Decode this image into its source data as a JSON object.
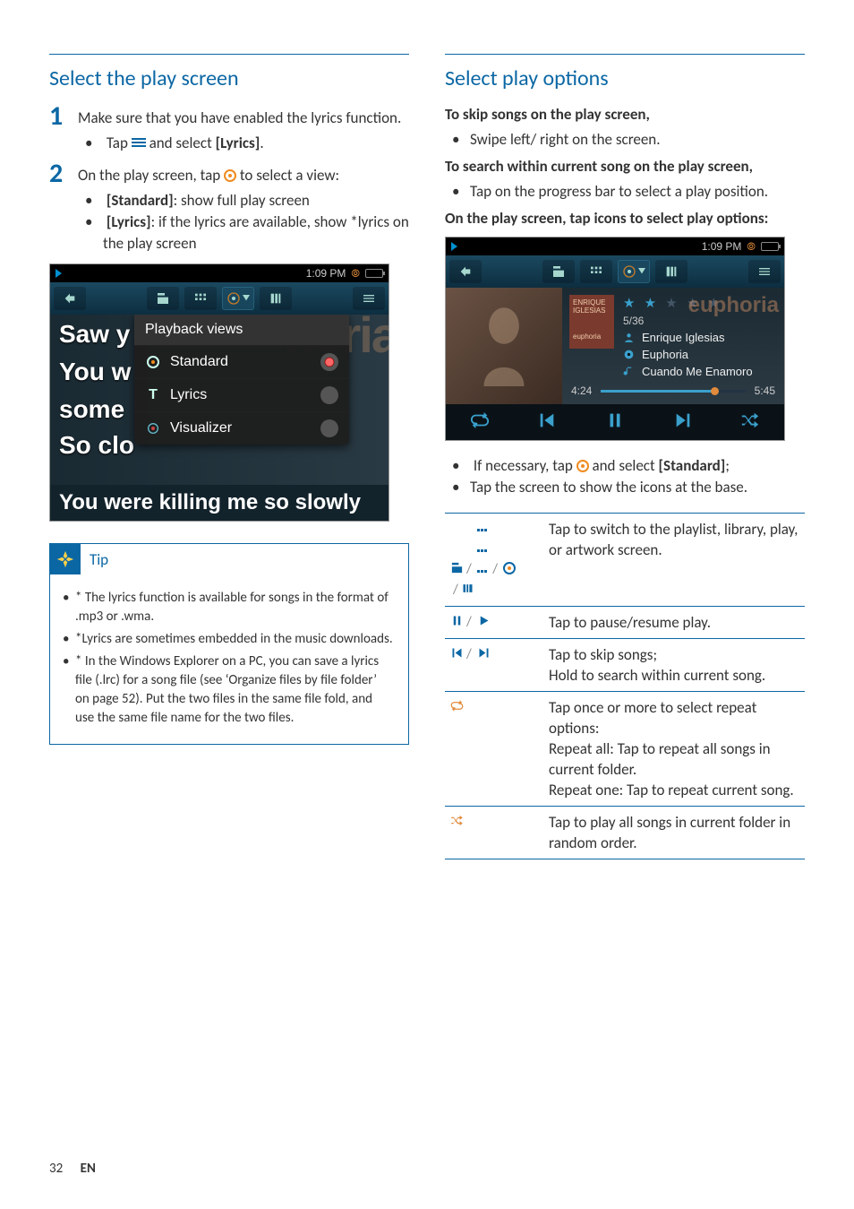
{
  "left": {
    "heading": "Select the play screen",
    "step1": {
      "text": "Make sure that you have enabled the lyrics function.",
      "bullet_a": "Tap ",
      "bullet_b": " and select ",
      "bullet_c": "[Lyrics]",
      "bullet_d": "."
    },
    "step2": {
      "text_a": "On the play screen, tap ",
      "text_b": " to select a view:",
      "opt_std_label": "[Standard]",
      "opt_std_desc": ": show full play screen",
      "opt_lyr_label": "[Lyrics]",
      "opt_lyr_desc": ": if the lyrics are available, show *lyrics on the play screen"
    },
    "mock": {
      "time": "1:09 PM",
      "ly1": "Saw y",
      "ly2": "You w",
      "ly3": "some",
      "ly4": "So clo",
      "bg": "noria",
      "popup_hdr": "Playback views",
      "row_std": "Standard",
      "row_lyr": "Lyrics",
      "row_vis": "Visualizer",
      "bigline": "You were killing me so slowly"
    },
    "tip": {
      "label": "Tip",
      "t1": "* The lyrics function is available for songs in the format of .mp3 or .wma.",
      "t2": "*Lyrics are sometimes embedded in the music downloads.",
      "t3": "* In the Windows Explorer on a PC, you can save a lyrics file (.lrc) for a song file (see ‘Organize files by file folder’ on page 52). Put the two files in the same file fold, and use the same file name for the two files."
    }
  },
  "right": {
    "heading": "Select play options",
    "p1": "To skip songs on the play screen,",
    "p1b": "Swipe left/ right on the screen.",
    "p2": "To search within current song on the play screen,",
    "p2b": "Tap on the progress bar to select a play position.",
    "p3": "On the play screen, tap icons to select play options:",
    "mock": {
      "time": "1:09 PM",
      "cover_top": "ENRIQUE IGLESIAS",
      "cover_bot": "euphoria",
      "brand": "euphoria",
      "track_idx": "5/36",
      "artist": "Enrique Iglesias",
      "album": "Euphoria",
      "song": "Cuando Me Enamoro",
      "t_cur": "4:24",
      "t_tot": "5:45"
    },
    "post": {
      "a1": "If necessary, tap ",
      "a2": " and select ",
      "a3": "[Standard]",
      "a4": ";",
      "b": "Tap the screen to show the icons at the base."
    },
    "table": {
      "r1": "Tap to switch to the playlist, library, play, or artwork screen.",
      "r2": "Tap to pause/resume play.",
      "r3": "Tap to skip songs;\nHold to search within current song.",
      "r4": "Tap once or more to select repeat options:\nRepeat all: Tap to repeat all songs in current folder.\nRepeat one: Tap to repeat current song.",
      "r5": "Tap to play all songs in current folder in random order."
    }
  },
  "footer": {
    "page": "32",
    "lang": "EN"
  }
}
